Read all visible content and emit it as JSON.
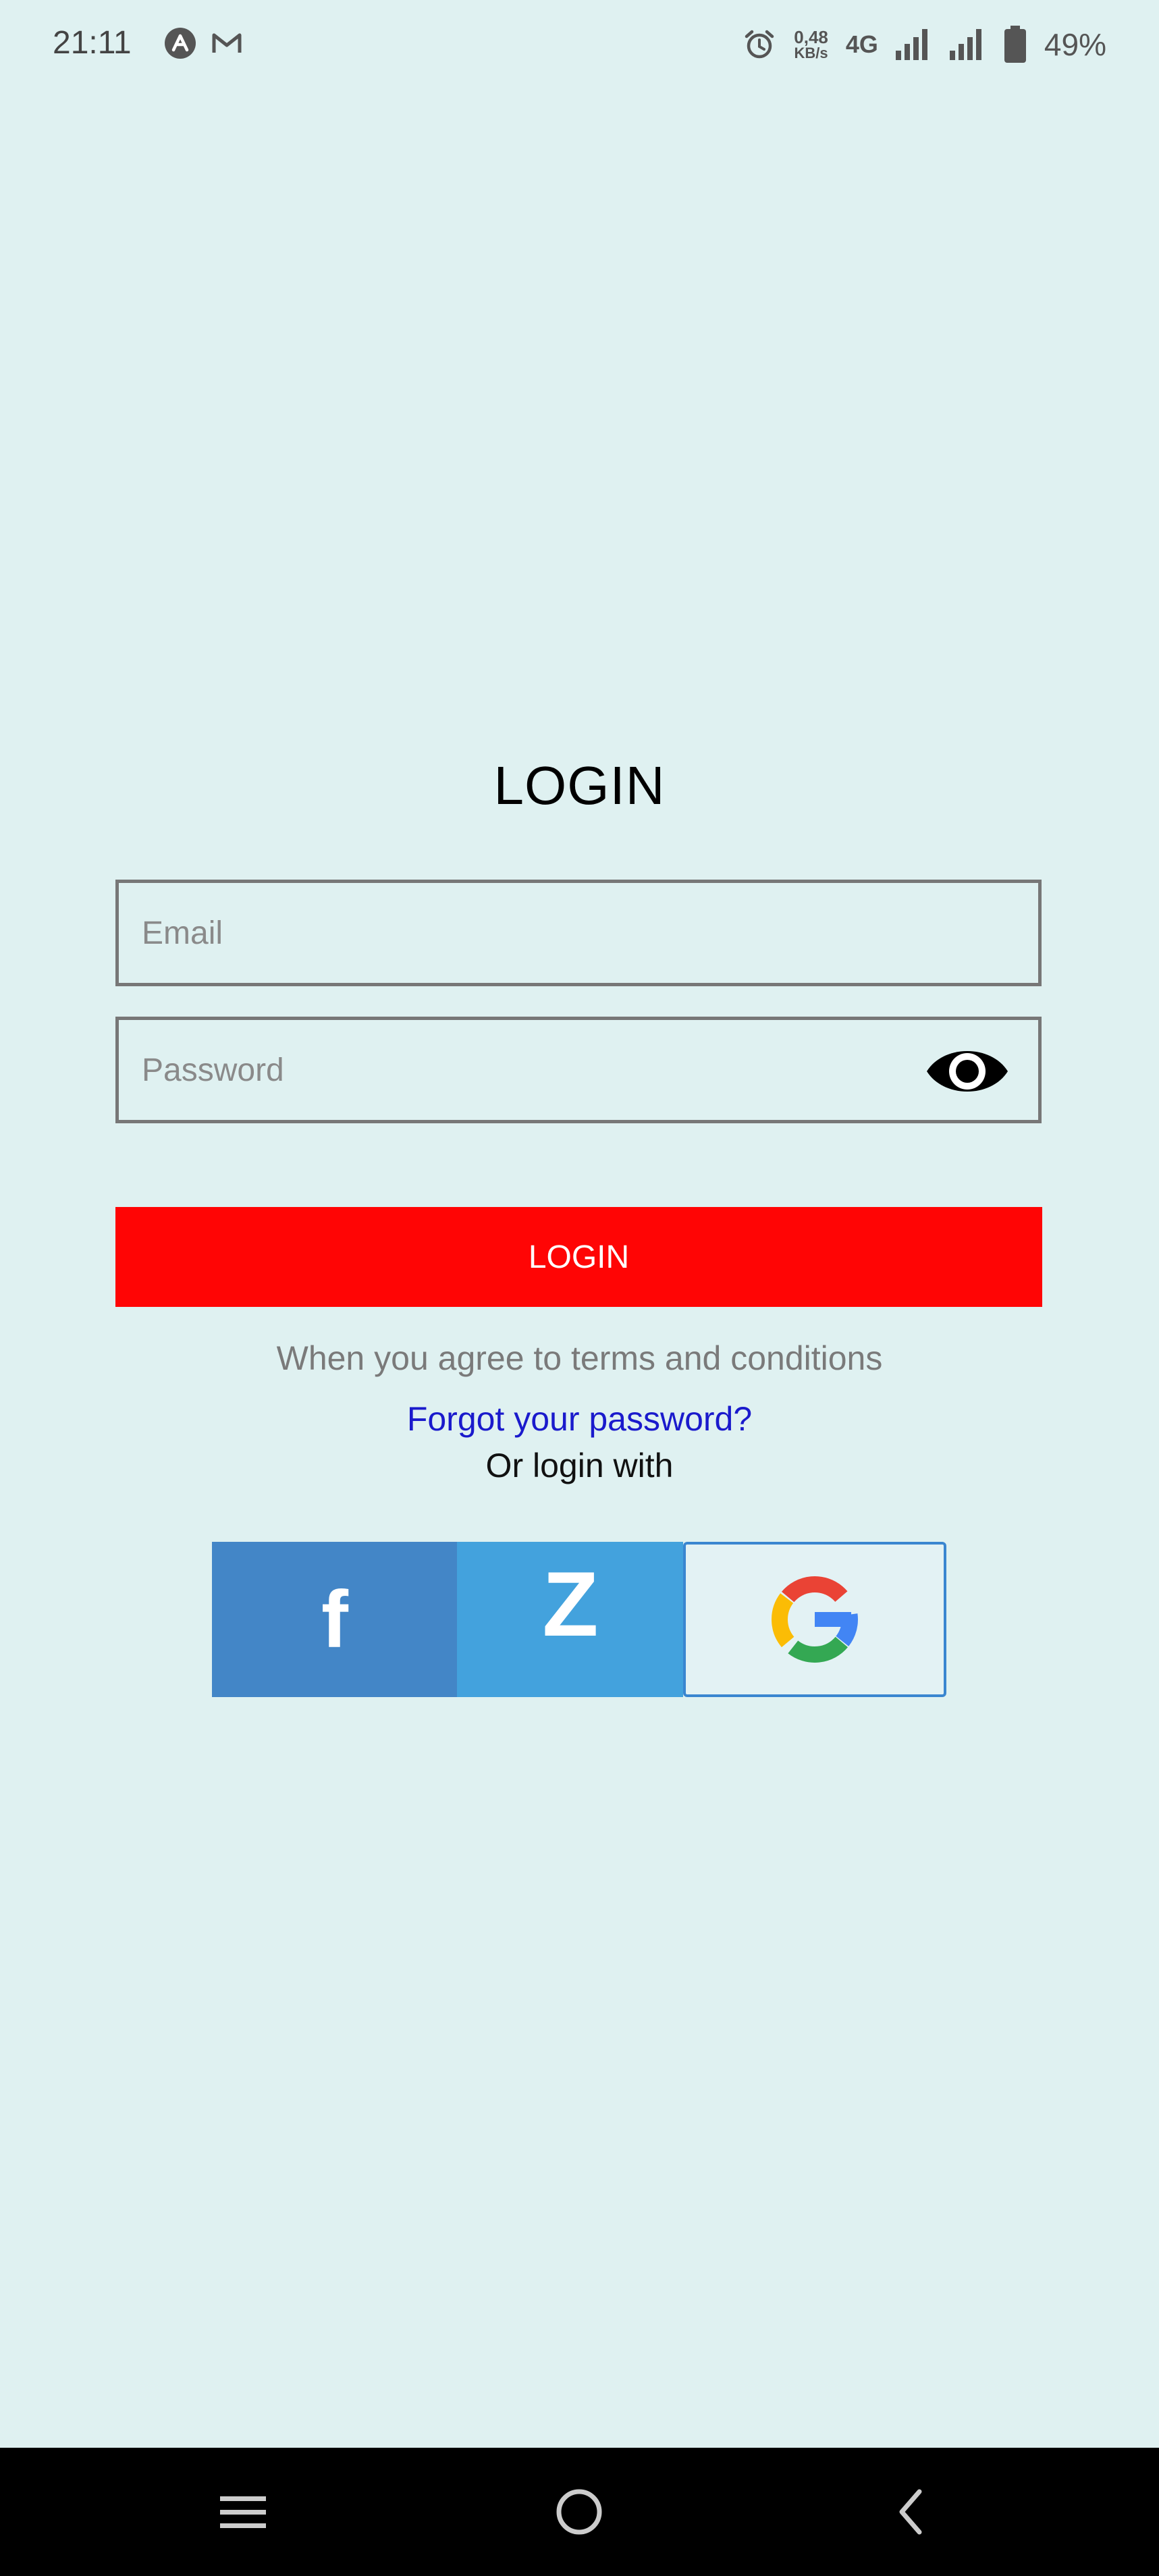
{
  "status_bar": {
    "time": "21:11",
    "speed_value": "0,48",
    "speed_unit": "KB/s",
    "network": "4G",
    "battery": "49%",
    "icons": [
      "app-a-icon",
      "gmail-icon",
      "alarm-icon",
      "signal-icon",
      "battery-icon"
    ]
  },
  "login": {
    "title": "LOGIN",
    "email_placeholder": "Email",
    "password_placeholder": "Password",
    "button_label": "LOGIN",
    "terms_text": "When you agree to terms and conditions",
    "forgot_link": "Forgot your password?",
    "or_login_with": "Or login with"
  },
  "social": {
    "facebook_letter": "f",
    "zalo_letter": "Z",
    "google_letter": "G"
  },
  "colors": {
    "background": "#dff1f1",
    "login_button": "#ff0505",
    "facebook": "#4386c7",
    "zalo": "#43a2dd",
    "link": "#1a1acc"
  }
}
